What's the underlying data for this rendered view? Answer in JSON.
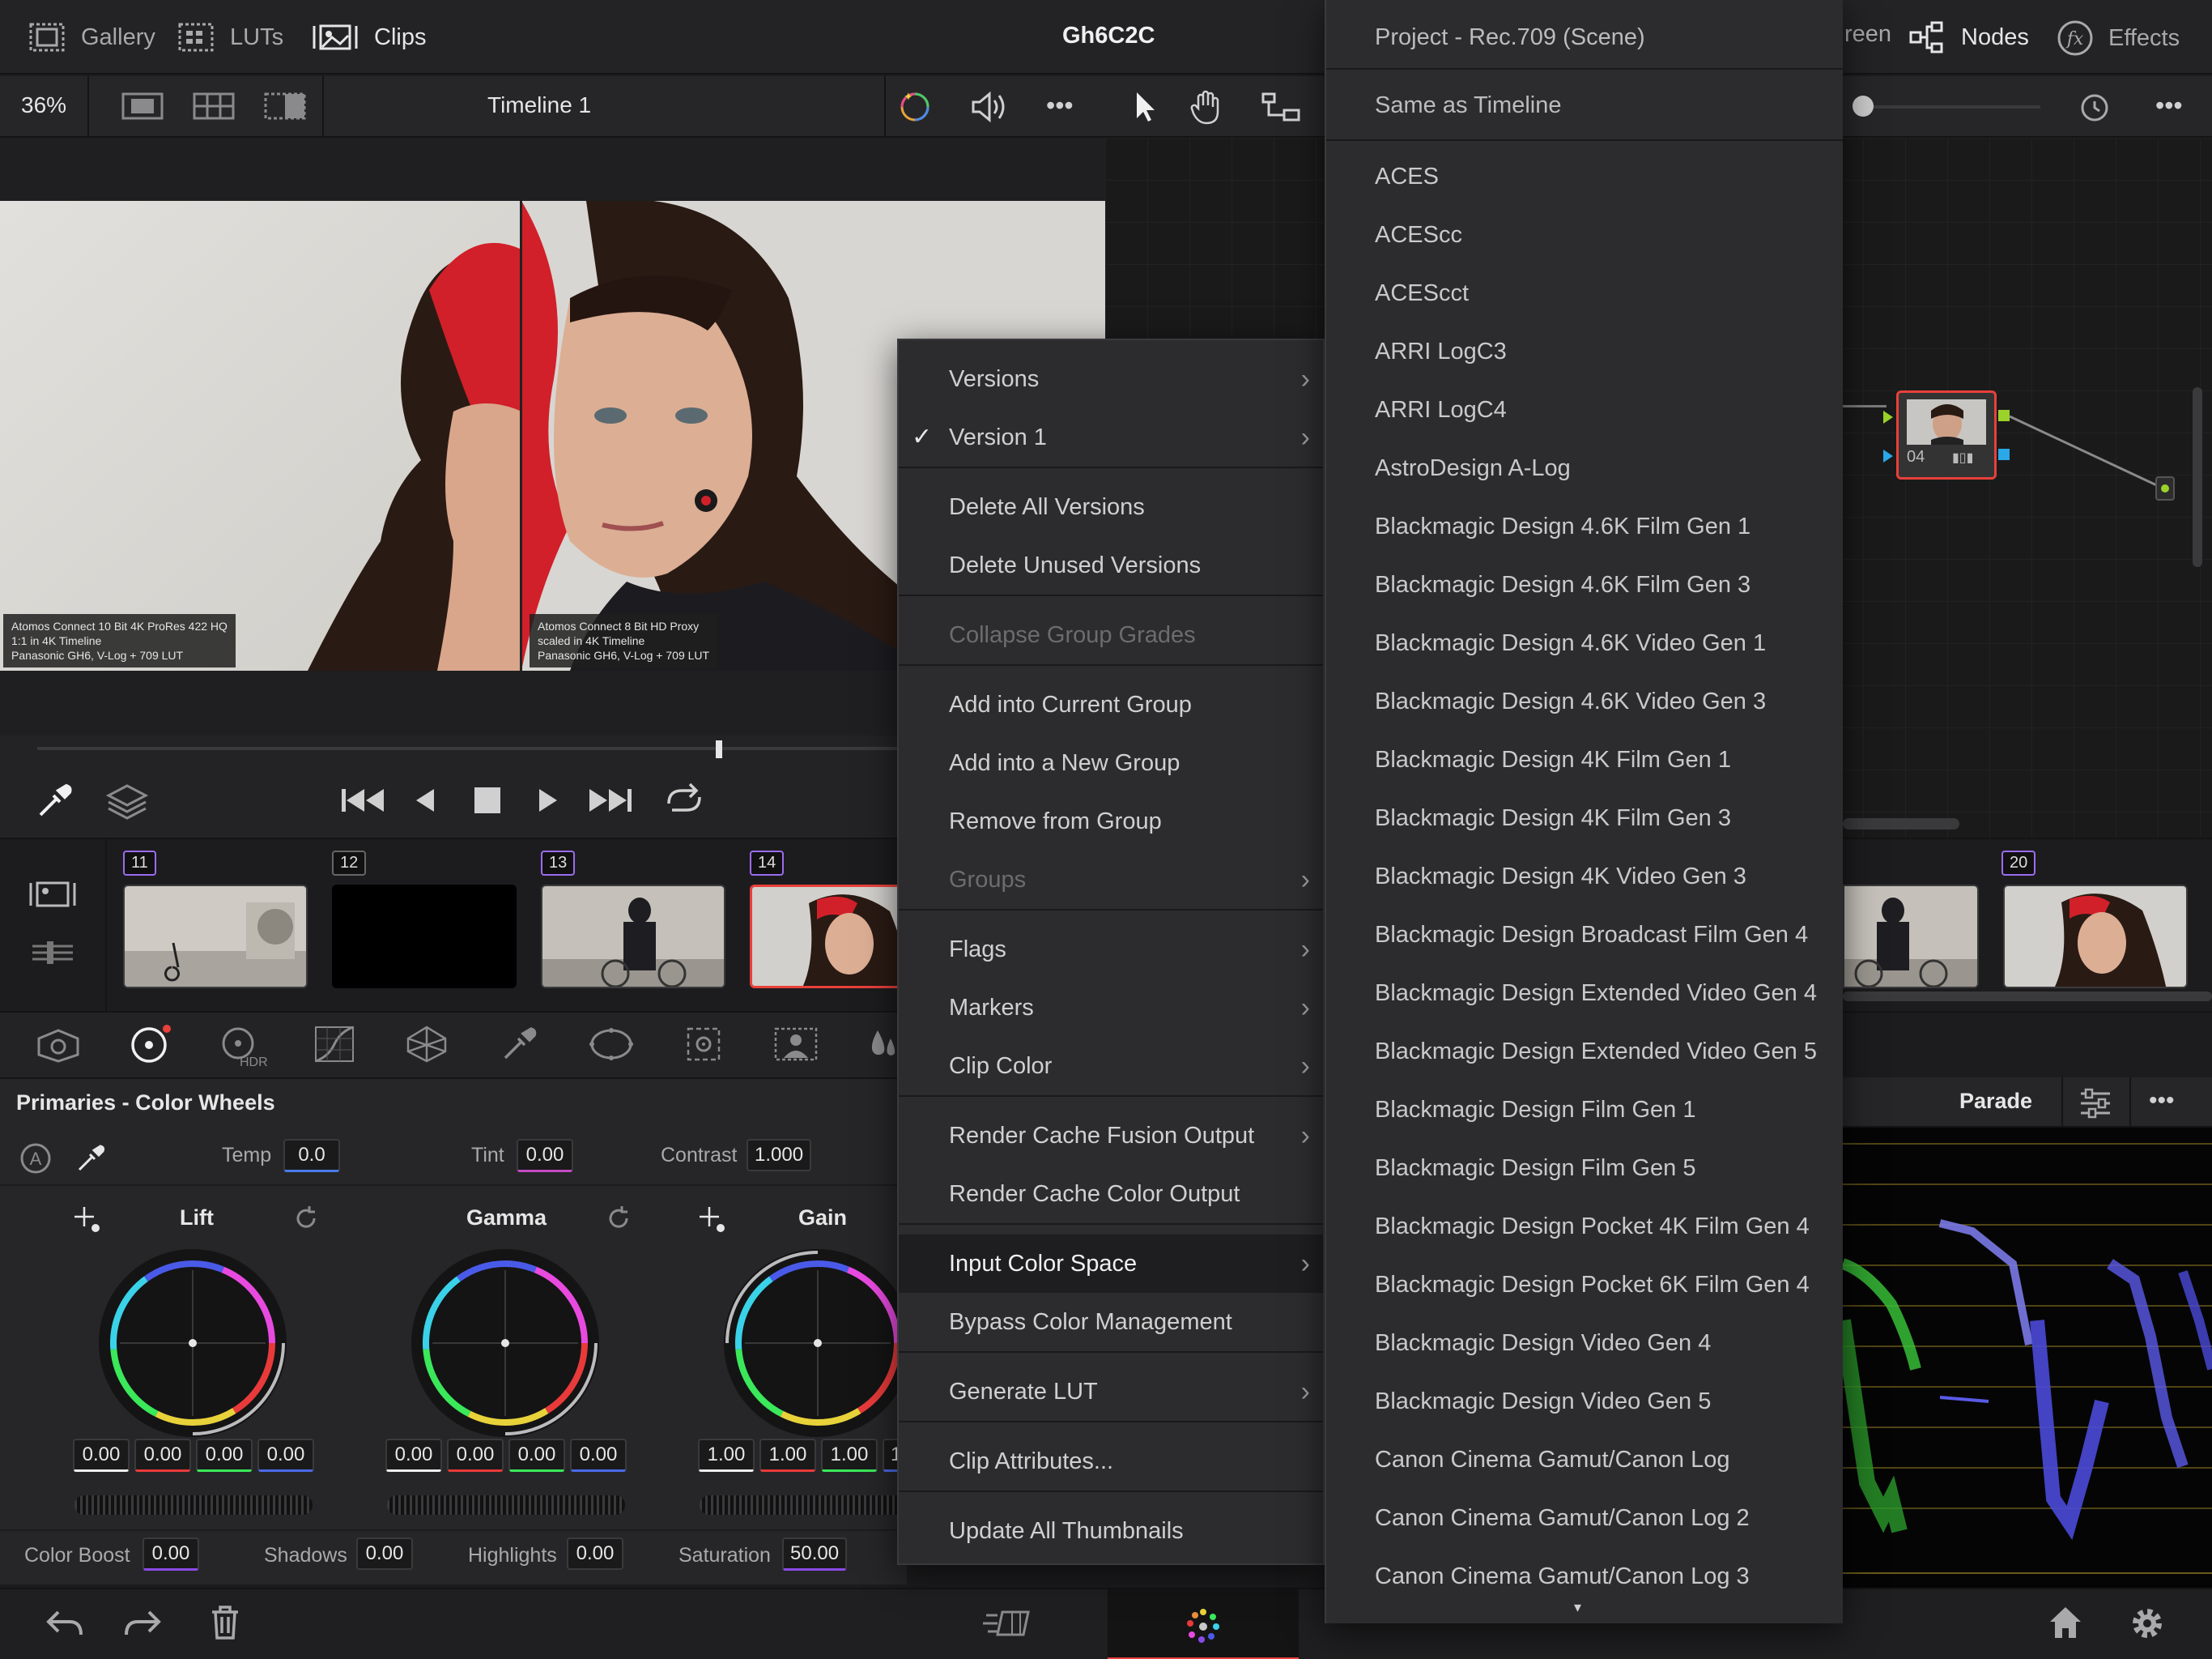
{
  "top": {
    "gallery": "Gallery",
    "luts": "LUTs",
    "clips": "Clips",
    "project_title": "Gh6C2C",
    "lightbox": "reen",
    "nodes": "Nodes",
    "effects": "Effects"
  },
  "viewer": {
    "zoom": "36%",
    "timeline": "Timeline 1",
    "caption_left": "Atomos Connect 10 Bit 4K ProRes 422 HQ\n1:1 in 4K Timeline\nPanasonic GH6, V-Log + 709 LUT",
    "caption_right": "Atomos Connect 8 Bit HD Proxy\nscaled in 4K Timeline\nPanasonic GH6, V-Log + 709 LUT"
  },
  "clips": {
    "items": [
      {
        "num": "11",
        "color": "#9b6cf0"
      },
      {
        "num": "12",
        "color": "#888888"
      },
      {
        "num": "13",
        "color": "#9b6cf0"
      },
      {
        "num": "14",
        "color": "#9b6cf0"
      },
      {
        "num": "20",
        "color": "#9b6cf0"
      }
    ]
  },
  "node": {
    "label": "04"
  },
  "primaries": {
    "title": "Primaries - Color Wheels",
    "temp_label": "Temp",
    "temp": "0.0",
    "tint_label": "Tint",
    "tint": "0.00",
    "contrast_label": "Contrast",
    "contrast": "1.000",
    "lift": "Lift",
    "gamma": "Gamma",
    "gain": "Gain",
    "lift_vals": [
      "0.00",
      "0.00",
      "0.00",
      "0.00"
    ],
    "gamma_vals": [
      "0.00",
      "0.00",
      "0.00",
      "0.00"
    ],
    "gain_vals": [
      "1.00",
      "1.00",
      "1.00",
      "1"
    ],
    "color_boost_label": "Color Boost",
    "color_boost": "0.00",
    "shadows_label": "Shadows",
    "shadows": "0.00",
    "highlights_label": "Highlights",
    "highlights": "0.00",
    "saturation_label": "Saturation",
    "saturation": "50.00"
  },
  "scope": {
    "mode": "Parade"
  },
  "context_menu": {
    "items": [
      {
        "label": "Versions",
        "arrow": true
      },
      {
        "label": "Version 1",
        "arrow": true,
        "checked": true
      },
      {
        "label": "Delete All Versions"
      },
      {
        "label": "Delete Unused Versions"
      },
      {
        "label": "Collapse Group Grades",
        "disabled": true
      },
      {
        "label": "Add into Current Group"
      },
      {
        "label": "Add into a New Group"
      },
      {
        "label": "Remove from Group"
      },
      {
        "label": "Groups",
        "arrow": true,
        "disabled": true
      },
      {
        "label": "Flags",
        "arrow": true
      },
      {
        "label": "Markers",
        "arrow": true
      },
      {
        "label": "Clip Color",
        "arrow": true
      },
      {
        "label": "Render Cache Fusion Output",
        "arrow": true
      },
      {
        "label": "Render Cache Color Output"
      },
      {
        "label": "Input Color Space",
        "arrow": true,
        "highlighted": true
      },
      {
        "label": "Bypass Color Management"
      },
      {
        "label": "Generate LUT",
        "arrow": true
      },
      {
        "label": "Clip Attributes..."
      },
      {
        "label": "Update All Thumbnails"
      }
    ]
  },
  "color_space_menu": {
    "header1": "Project - Rec.709 (Scene)",
    "header2": "Same as Timeline",
    "items": [
      "ACES",
      "ACEScc",
      "ACEScct",
      "ARRI LogC3",
      "ARRI LogC4",
      "AstroDesign A-Log",
      "Blackmagic Design 4.6K Film Gen 1",
      "Blackmagic Design 4.6K Film Gen 3",
      "Blackmagic Design 4.6K Video Gen 1",
      "Blackmagic Design 4.6K Video Gen 3",
      "Blackmagic Design 4K Film Gen 1",
      "Blackmagic Design 4K Film Gen 3",
      "Blackmagic Design 4K Video Gen 3",
      "Blackmagic Design Broadcast Film Gen 4",
      "Blackmagic Design Extended Video Gen 4",
      "Blackmagic Design Extended Video Gen 5",
      "Blackmagic Design Film Gen 1",
      "Blackmagic Design Film Gen 5",
      "Blackmagic Design Pocket 4K Film Gen 4",
      "Blackmagic Design Pocket 6K Film Gen 4",
      "Blackmagic Design Video Gen 4",
      "Blackmagic Design Video Gen 5",
      "Canon Cinema Gamut/Canon Log",
      "Canon Cinema Gamut/Canon Log 2",
      "Canon Cinema Gamut/Canon Log 3"
    ]
  },
  "colors": {
    "accent_red": "#e8403a",
    "menu_bg": "#2c2c2e",
    "highlight_bg": "#1e1e20"
  }
}
